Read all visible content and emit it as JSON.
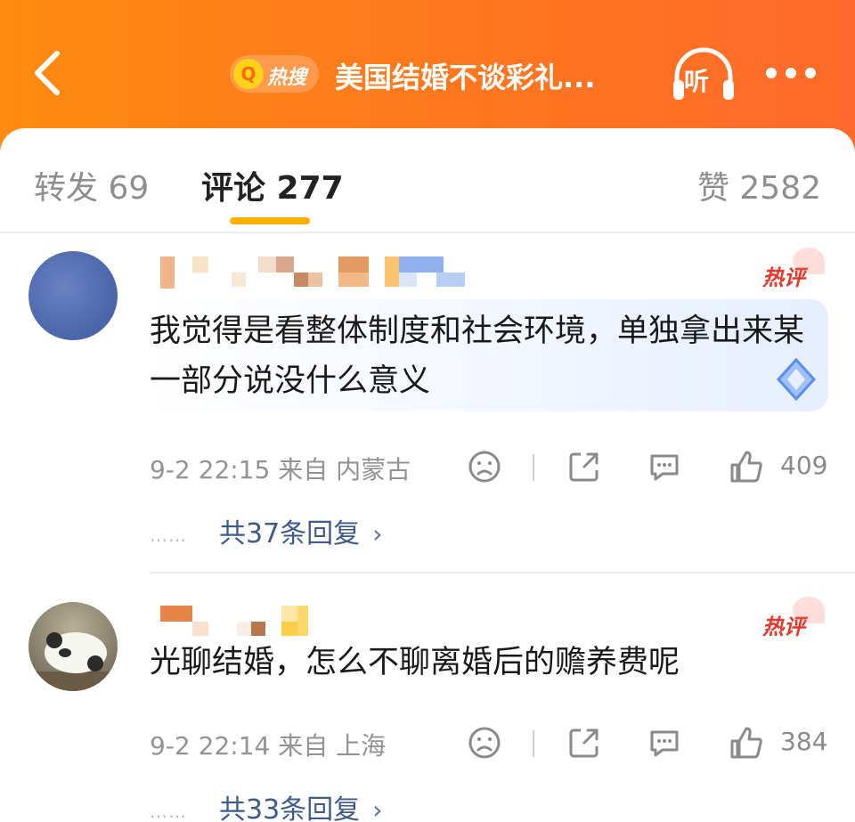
{
  "header": {
    "back_icon": "chevron-left-icon",
    "hot_search_q": "Q",
    "hot_search_label": "热搜",
    "title": "美国结婚不谈彩礼...",
    "listen_label": "听",
    "listen_icon": "headphones-icon",
    "more_icon": "more-dots-icon"
  },
  "tabs": {
    "repost": "转发 69",
    "comments": "评论 277",
    "likes": "赞 2582"
  },
  "colors": {
    "header_gradient_start": "#ff8a10",
    "header_gradient_end": "#ff6a2a",
    "tab_underline": "#ffb000",
    "hot_tag": "#e8362a",
    "reply_link": "#3d5a8a"
  },
  "comments": [
    {
      "hot_tag": "热评",
      "text": "我觉得是看整体制度和社会环境，单独拿出来某一部分说没什么意义",
      "meta": "9-2 22:15 来自 内蒙古",
      "likes": "409",
      "replies": "共37条回复",
      "dots": "……",
      "chevron": "›"
    },
    {
      "hot_tag": "热评",
      "text": "光聊结婚，怎么不聊离婚后的赡养费呢",
      "meta": "9-2 22:14 来自 上海",
      "likes": "384",
      "replies": "共33条回复",
      "dots": "……",
      "chevron": "›"
    }
  ]
}
